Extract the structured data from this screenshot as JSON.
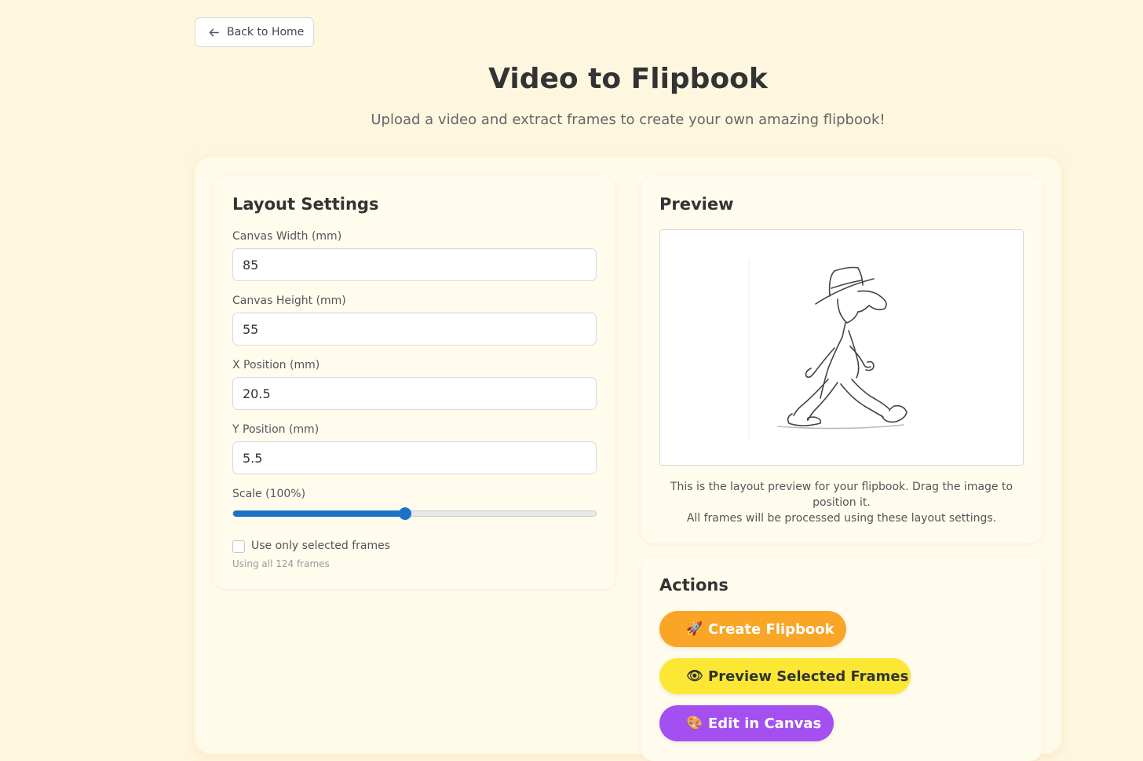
{
  "nav": {
    "back_label": "Back to Home",
    "back_icon": "arrow-left-icon"
  },
  "header": {
    "title": "Video to Flipbook",
    "subtitle": "Upload a video and extract frames to create your own amazing flipbook!"
  },
  "layout_settings": {
    "heading": "Layout Settings",
    "fields": [
      {
        "label": "Canvas Width (mm)",
        "value": "85"
      },
      {
        "label": "Canvas Height (mm)",
        "value": "55"
      },
      {
        "label": "X Position (mm)",
        "value": "20.5"
      },
      {
        "label": "Y Position (mm)",
        "value": "5.5"
      }
    ],
    "scale_label": "Scale (100%)",
    "scale_slider_fraction": 0.475,
    "checkbox_label": "Use only selected frames",
    "checkbox_checked": false,
    "frames_hint": "Using all 124 frames"
  },
  "preview": {
    "heading": "Preview",
    "image_icon": "sketch-walking-man-image",
    "caption_line1": "This is the layout preview for your flipbook. Drag the image to position it.",
    "caption_line2": "All frames will be processed using these layout settings."
  },
  "actions": {
    "heading": "Actions",
    "buttons": [
      {
        "label": "Create Flipbook",
        "icon": "rocket-icon",
        "color": "#f9a526"
      },
      {
        "label": "Preview Selected Frames",
        "icon": "eye-icon",
        "color": "#fce834"
      },
      {
        "label": "Edit in Canvas",
        "icon": "palette-icon",
        "color": "#a450f0"
      }
    ]
  },
  "colors": {
    "background": "#fef7e0",
    "slider_accent": "#1a73c8"
  }
}
